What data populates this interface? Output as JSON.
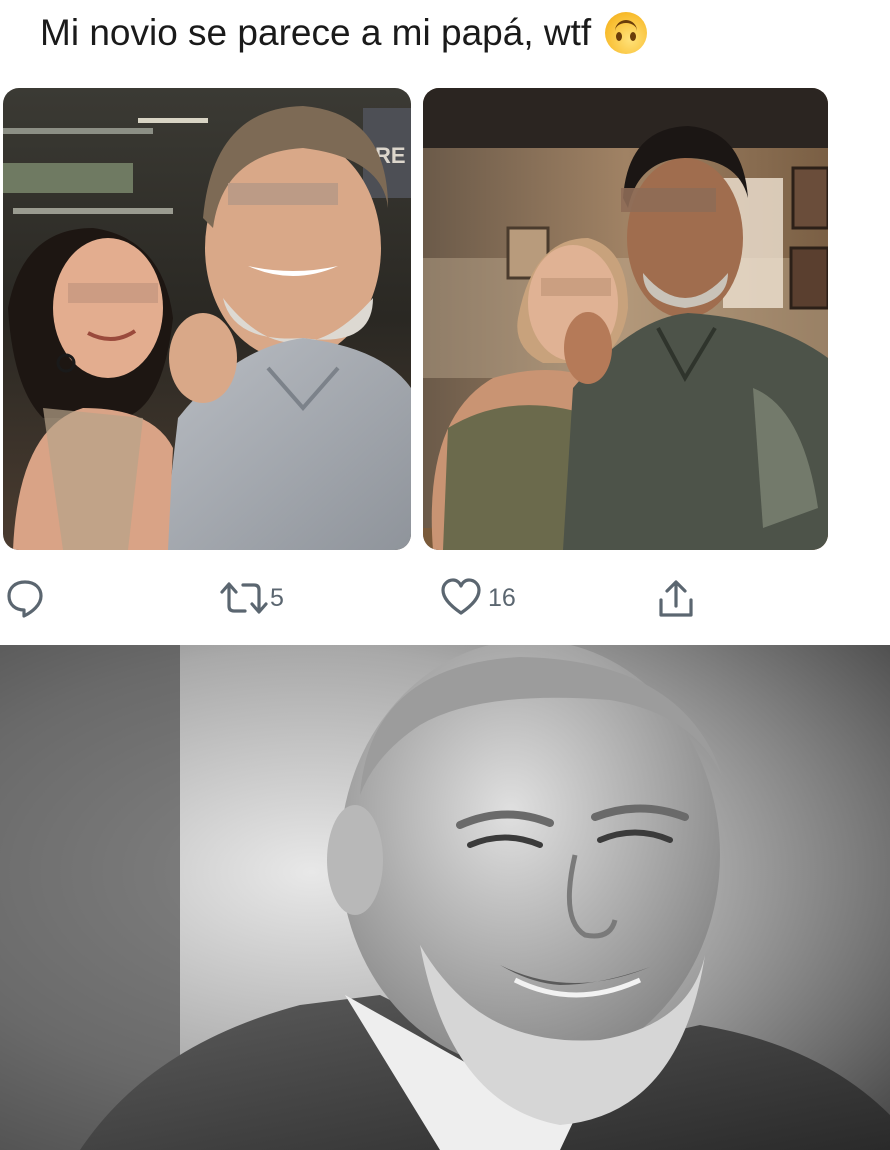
{
  "tweet": {
    "text": "Mi novio se parece a mi papá, wtf",
    "emoji_icon": "upside-down-face-emoji",
    "photos": [
      {
        "name": "couple-photo-restaurant-left",
        "blurred_faces": true
      },
      {
        "name": "couple-photo-restaurant-right",
        "blurred_faces": true
      }
    ],
    "actions": {
      "reply_icon": "speech-bubble-icon",
      "retweet_icon": "retweet-icon",
      "retweet_count": "5",
      "like_icon": "heart-icon",
      "like_count": "16",
      "share_icon": "share-icon"
    }
  },
  "meme_image": {
    "name": "grayscale-portrait-bearded-man",
    "style": "black-and-white"
  },
  "colors": {
    "background": "#ffffff",
    "text": "#1a1a1a",
    "icon_gray": "#5b6670"
  }
}
